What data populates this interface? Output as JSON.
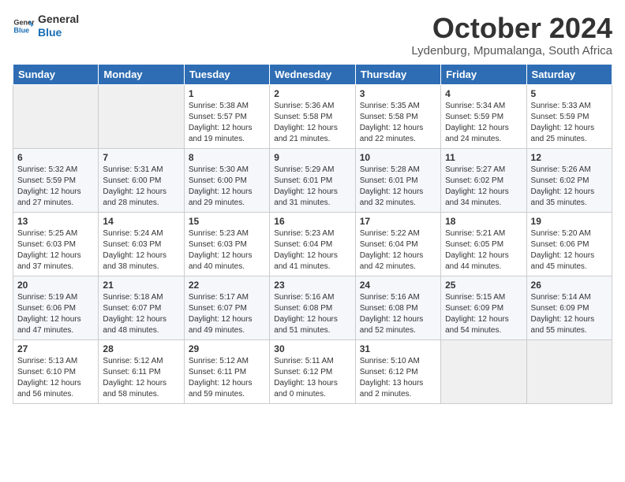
{
  "logo": {
    "line1": "General",
    "line2": "Blue"
  },
  "title": "October 2024",
  "location": "Lydenburg, Mpumalanga, South Africa",
  "days_of_week": [
    "Sunday",
    "Monday",
    "Tuesday",
    "Wednesday",
    "Thursday",
    "Friday",
    "Saturday"
  ],
  "weeks": [
    [
      {
        "day": "",
        "content": ""
      },
      {
        "day": "",
        "content": ""
      },
      {
        "day": "1",
        "content": "Sunrise: 5:38 AM\nSunset: 5:57 PM\nDaylight: 12 hours\nand 19 minutes."
      },
      {
        "day": "2",
        "content": "Sunrise: 5:36 AM\nSunset: 5:58 PM\nDaylight: 12 hours\nand 21 minutes."
      },
      {
        "day": "3",
        "content": "Sunrise: 5:35 AM\nSunset: 5:58 PM\nDaylight: 12 hours\nand 22 minutes."
      },
      {
        "day": "4",
        "content": "Sunrise: 5:34 AM\nSunset: 5:59 PM\nDaylight: 12 hours\nand 24 minutes."
      },
      {
        "day": "5",
        "content": "Sunrise: 5:33 AM\nSunset: 5:59 PM\nDaylight: 12 hours\nand 25 minutes."
      }
    ],
    [
      {
        "day": "6",
        "content": "Sunrise: 5:32 AM\nSunset: 5:59 PM\nDaylight: 12 hours\nand 27 minutes."
      },
      {
        "day": "7",
        "content": "Sunrise: 5:31 AM\nSunset: 6:00 PM\nDaylight: 12 hours\nand 28 minutes."
      },
      {
        "day": "8",
        "content": "Sunrise: 5:30 AM\nSunset: 6:00 PM\nDaylight: 12 hours\nand 29 minutes."
      },
      {
        "day": "9",
        "content": "Sunrise: 5:29 AM\nSunset: 6:01 PM\nDaylight: 12 hours\nand 31 minutes."
      },
      {
        "day": "10",
        "content": "Sunrise: 5:28 AM\nSunset: 6:01 PM\nDaylight: 12 hours\nand 32 minutes."
      },
      {
        "day": "11",
        "content": "Sunrise: 5:27 AM\nSunset: 6:02 PM\nDaylight: 12 hours\nand 34 minutes."
      },
      {
        "day": "12",
        "content": "Sunrise: 5:26 AM\nSunset: 6:02 PM\nDaylight: 12 hours\nand 35 minutes."
      }
    ],
    [
      {
        "day": "13",
        "content": "Sunrise: 5:25 AM\nSunset: 6:03 PM\nDaylight: 12 hours\nand 37 minutes."
      },
      {
        "day": "14",
        "content": "Sunrise: 5:24 AM\nSunset: 6:03 PM\nDaylight: 12 hours\nand 38 minutes."
      },
      {
        "day": "15",
        "content": "Sunrise: 5:23 AM\nSunset: 6:03 PM\nDaylight: 12 hours\nand 40 minutes."
      },
      {
        "day": "16",
        "content": "Sunrise: 5:23 AM\nSunset: 6:04 PM\nDaylight: 12 hours\nand 41 minutes."
      },
      {
        "day": "17",
        "content": "Sunrise: 5:22 AM\nSunset: 6:04 PM\nDaylight: 12 hours\nand 42 minutes."
      },
      {
        "day": "18",
        "content": "Sunrise: 5:21 AM\nSunset: 6:05 PM\nDaylight: 12 hours\nand 44 minutes."
      },
      {
        "day": "19",
        "content": "Sunrise: 5:20 AM\nSunset: 6:06 PM\nDaylight: 12 hours\nand 45 minutes."
      }
    ],
    [
      {
        "day": "20",
        "content": "Sunrise: 5:19 AM\nSunset: 6:06 PM\nDaylight: 12 hours\nand 47 minutes."
      },
      {
        "day": "21",
        "content": "Sunrise: 5:18 AM\nSunset: 6:07 PM\nDaylight: 12 hours\nand 48 minutes."
      },
      {
        "day": "22",
        "content": "Sunrise: 5:17 AM\nSunset: 6:07 PM\nDaylight: 12 hours\nand 49 minutes."
      },
      {
        "day": "23",
        "content": "Sunrise: 5:16 AM\nSunset: 6:08 PM\nDaylight: 12 hours\nand 51 minutes."
      },
      {
        "day": "24",
        "content": "Sunrise: 5:16 AM\nSunset: 6:08 PM\nDaylight: 12 hours\nand 52 minutes."
      },
      {
        "day": "25",
        "content": "Sunrise: 5:15 AM\nSunset: 6:09 PM\nDaylight: 12 hours\nand 54 minutes."
      },
      {
        "day": "26",
        "content": "Sunrise: 5:14 AM\nSunset: 6:09 PM\nDaylight: 12 hours\nand 55 minutes."
      }
    ],
    [
      {
        "day": "27",
        "content": "Sunrise: 5:13 AM\nSunset: 6:10 PM\nDaylight: 12 hours\nand 56 minutes."
      },
      {
        "day": "28",
        "content": "Sunrise: 5:12 AM\nSunset: 6:11 PM\nDaylight: 12 hours\nand 58 minutes."
      },
      {
        "day": "29",
        "content": "Sunrise: 5:12 AM\nSunset: 6:11 PM\nDaylight: 12 hours\nand 59 minutes."
      },
      {
        "day": "30",
        "content": "Sunrise: 5:11 AM\nSunset: 6:12 PM\nDaylight: 13 hours\nand 0 minutes."
      },
      {
        "day": "31",
        "content": "Sunrise: 5:10 AM\nSunset: 6:12 PM\nDaylight: 13 hours\nand 2 minutes."
      },
      {
        "day": "",
        "content": ""
      },
      {
        "day": "",
        "content": ""
      }
    ]
  ]
}
